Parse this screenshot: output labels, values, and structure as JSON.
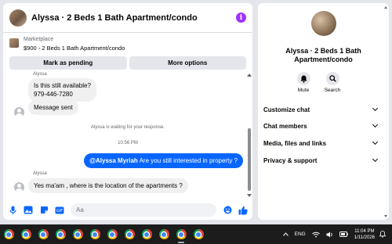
{
  "chat": {
    "title": "Alyssa · 2 Beds 1 Bath Apartment/condo",
    "marketplace": {
      "label": "Marketplace",
      "detail": "$900 - 2 Beds 1 Bath Apartment/condo",
      "pending_button": "Mark as pending",
      "more_button": "More options"
    },
    "messages": {
      "sender_1": "Alyssa",
      "bubble_1_line1": "Is this still available?",
      "bubble_1_line2": "979-446-7280",
      "bubble_2": "Message sent",
      "waiting_note": "Alyssa is waiting for your response.",
      "timestamp": "10:56 PM",
      "outgoing_mention": "@Alyssa Myriah",
      "outgoing_text": "Are you still interested in property ?",
      "sender_2": "Alyssa",
      "bubble_3": "Yes ma'am , where is the location of the apartments ?"
    },
    "composer": {
      "placeholder": "Aa"
    }
  },
  "info_panel": {
    "title": "Alyssa · 2 Beds 1 Bath Apartment/condo",
    "actions": [
      {
        "label": "Mute",
        "icon": "bell-icon"
      },
      {
        "label": "Search",
        "icon": "search-icon"
      }
    ],
    "sections": [
      "Customize chat",
      "Chat members",
      "Media, files and links",
      "Privacy & support"
    ]
  },
  "taskbar": {
    "app_count": 12,
    "app_icon": "chrome-icon",
    "language": "ENG",
    "time": "11:04 PM",
    "date": "1/11/2026"
  },
  "colors": {
    "accent_blue": "#0866ff",
    "info_purple": "#a033ff",
    "taskbar": "#1c1c1c"
  }
}
